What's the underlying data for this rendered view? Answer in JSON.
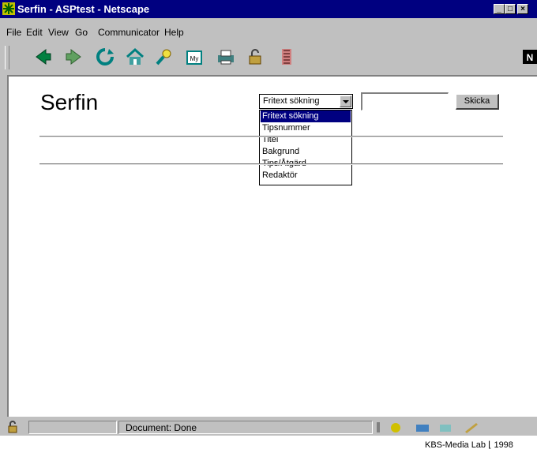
{
  "window": {
    "title": "Serfin - ASPtest - Netscape"
  },
  "title_buttons": [
    "minimize-button",
    "maximize-button",
    "close-button"
  ],
  "menu": [
    "File",
    "Edit",
    "View",
    "Go",
    "Communicator",
    "Help"
  ],
  "toolbar_icons": [
    "back-icon",
    "forward-icon",
    "reload-icon",
    "home-icon",
    "search-icon",
    "my-netscape-icon",
    "print-icon",
    "security-icon",
    "stop-icon"
  ],
  "page": {
    "logo": "Serfin",
    "search_select": {
      "selected": "Fritext sökning",
      "options": [
        "Fritext sökning",
        "Tipsnummer",
        "Titel",
        "Bakgrund",
        "Tips/Åtgärd",
        "Redaktör"
      ]
    },
    "search_input": "",
    "submit_label": "Skicka"
  },
  "status": {
    "text": "Document: Done"
  },
  "caption": "KBS-Media Lab ⌊ 1998",
  "colors": {
    "titlebar": "#000080",
    "chrome": "#c0c0c0",
    "selection": "#000080"
  }
}
